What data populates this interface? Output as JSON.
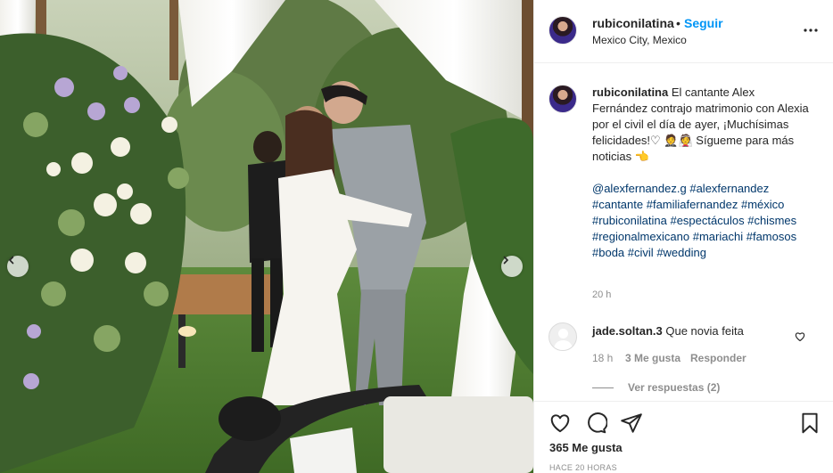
{
  "post": {
    "username": "rubiconilatina",
    "dot": "•",
    "follow_label": "Seguir",
    "location": "Mexico City, Mexico",
    "caption_text": "El cantante Alex Fernández contrajo matrimonio con Alexia por el civil el día de ayer, ¡Muchísimas felicidades!♡ 🤵👰 Sígueme para más noticias 👈",
    "hashtags": [
      "@alexfernandez.g",
      "#alexfernandez",
      "#cantante",
      "#familiafernandez",
      "#méxico",
      "#rubiconilatina",
      "#espectáculos",
      "#chismes",
      "#regionalmexicano",
      "#mariachi",
      "#famosos",
      "#boda",
      "#civil",
      "#wedding"
    ],
    "caption_time": "20 h",
    "comment": {
      "username": "jade.soltan.3",
      "text": "Que novia feita",
      "time": "18 h",
      "likes": "3 Me gusta",
      "reply_label": "Responder",
      "view_replies": "Ver respuestas (2)"
    },
    "likes_count": "365 Me gusta",
    "posted_ago": "HACE 20 HORAS"
  },
  "icons": {
    "like": "heart-icon",
    "comment": "comment-icon",
    "share": "paper-plane-icon",
    "save": "bookmark-icon",
    "more": "more-horizontal-icon",
    "prev": "chevron-left-icon",
    "next": "chevron-right-icon"
  },
  "colors": {
    "accent": "#0095f6",
    "hashtag": "#00376b",
    "muted": "#8e8e8e",
    "text": "#262626"
  }
}
